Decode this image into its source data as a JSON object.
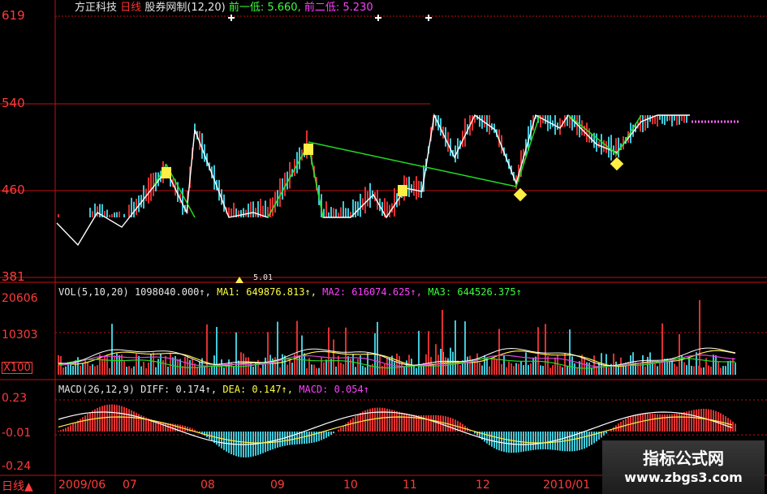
{
  "header": {
    "stock_name": "方正科技",
    "period": "日线",
    "indicator": "股券网制(12,20)",
    "prev_low1_label": "前一低:",
    "prev_low1_value": "5.660,",
    "prev_low2_label": "前二低:",
    "prev_low2_value": "5.230"
  },
  "price_axis": {
    "labels": [
      "619",
      "540",
      "460",
      "381"
    ]
  },
  "price_annotation": "5.01",
  "volume_panel": {
    "name": "VOL(5,10,20)",
    "value": "1098040.000↑,",
    "ma1": "MA1: 649876.813↑,",
    "ma2": "MA2: 616074.625↑,",
    "ma3": "MA3: 644526.375↑",
    "axis": [
      "20606",
      "10303",
      "X100"
    ]
  },
  "macd_panel": {
    "name": "MACD(26,12,9)",
    "diff": "DIFF: 0.174↑,",
    "dea": "DEA: 0.147↑,",
    "macd": "MACD: 0.054↑",
    "axis": [
      "0.23",
      "-0.01",
      "-0.24"
    ]
  },
  "bottom_bar": {
    "period_button": "日线▲",
    "dates": [
      "2009/06",
      "07",
      "08",
      "09",
      "10",
      "11",
      "12",
      "2010/01"
    ]
  },
  "watermark": {
    "title": "指标公式网",
    "url": "www.zbgs3.com"
  },
  "colors": {
    "axis_red": "#ff3b3b",
    "zigzag_white": "#ffffff",
    "trend_green": "#22dd22",
    "ma_yellow": "#ffee44",
    "ma_magenta": "#dd44dd"
  }
}
